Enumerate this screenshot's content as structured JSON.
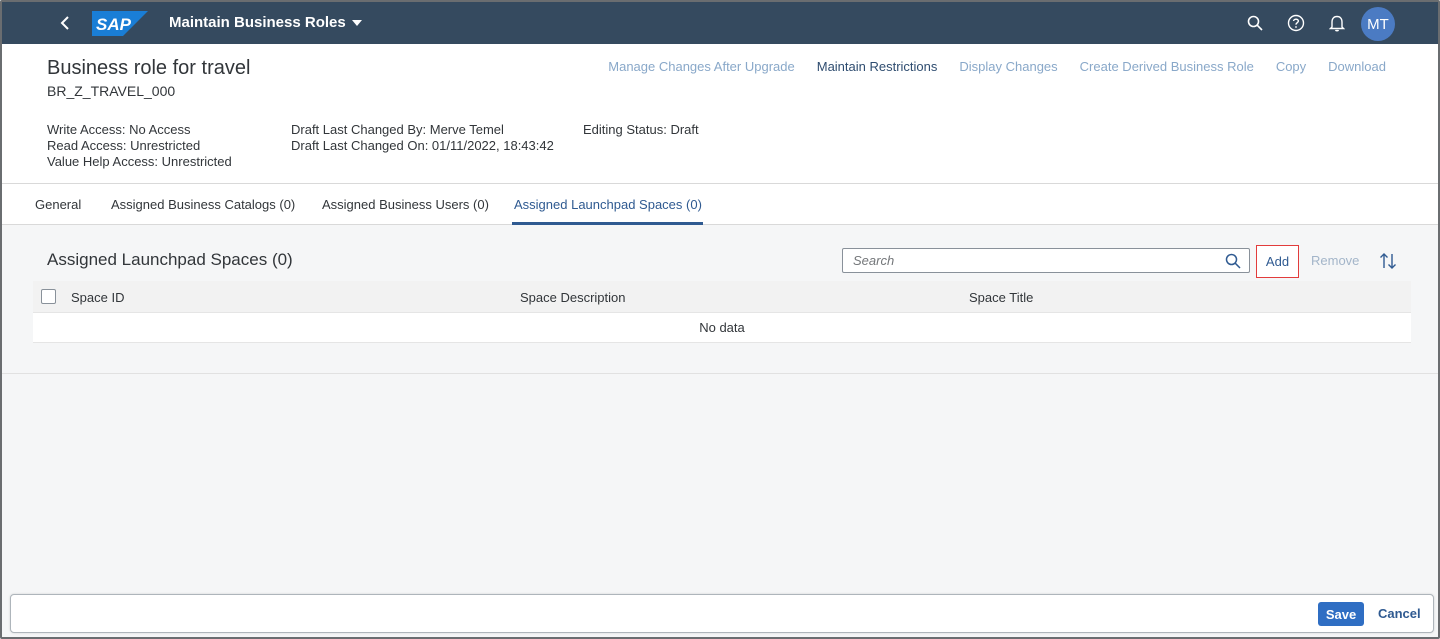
{
  "shell": {
    "logo_text": "SAP",
    "app_title": "Maintain Business Roles",
    "avatar_initials": "MT",
    "colors": {
      "shellbar": "#354a5f",
      "avatar": "#4b7bc3",
      "logo": "#1a7ed6"
    }
  },
  "header": {
    "title": "Business role for travel",
    "subtitle": "BR_Z_TRAVEL_000",
    "actions": [
      "Manage Changes After Upgrade",
      "Maintain Restrictions",
      "Display Changes",
      "Create Derived Business Role",
      "Copy",
      "Download"
    ],
    "attributes_col1": [
      "Write Access: No Access",
      "Read Access: Unrestricted",
      "Value Help Access: Unrestricted"
    ],
    "attributes_col2": [
      "Draft Last Changed By: Merve Temel",
      "Draft Last Changed On: 01/11/2022, 18:43:42"
    ],
    "attributes_col3": [
      "Editing Status: Draft"
    ]
  },
  "tabs": [
    "General",
    "Assigned Business Catalogs (0)",
    "Assigned Business Users (0)",
    "Assigned Launchpad Spaces (0)"
  ],
  "section": {
    "title": "Assigned Launchpad Spaces (0)",
    "search_placeholder": "Search",
    "add_label": "Add",
    "remove_label": "Remove"
  },
  "table": {
    "columns": [
      "Space ID",
      "Space Description",
      "Space Title"
    ],
    "empty_text": "No data"
  },
  "footer": {
    "save_label": "Save",
    "cancel_label": "Cancel"
  }
}
